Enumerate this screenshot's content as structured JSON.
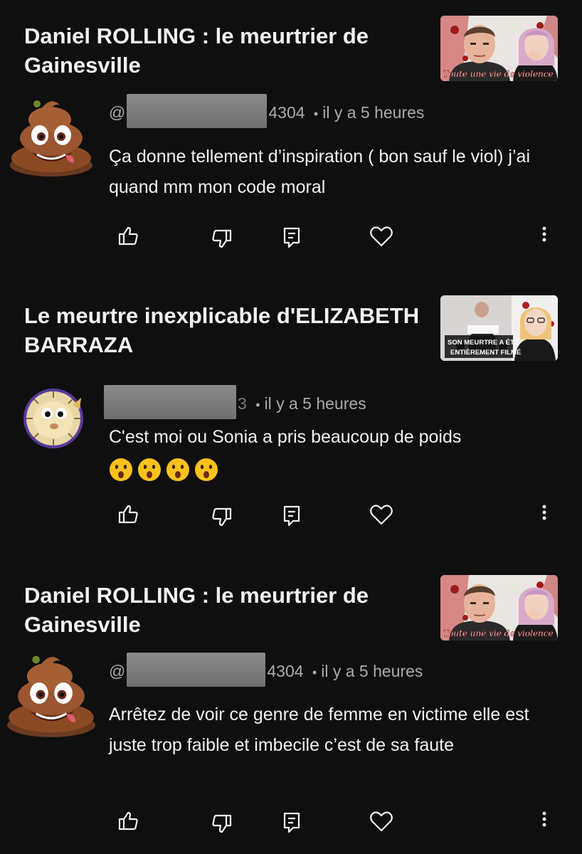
{
  "colors": {
    "background": "#0f0f0f",
    "primary_text": "#f1f1f1",
    "secondary_text": "#aaaaaa",
    "redaction": "#7a7a7a"
  },
  "items": [
    {
      "video_title": "Daniel ROLLING : le meurtrier de Gainesville",
      "thumbnail_caption": "Toute une vie de violence",
      "avatar_icon": "poop-emoji-icon",
      "handle_prefix": "@",
      "handle_suffix": "4304",
      "separator": "•",
      "timestamp": "il y a 5 heures",
      "comment": "Ça donne tellement d’inspiration ( bon sauf le viol) j’ai quand mm mon code moral",
      "emoji": []
    },
    {
      "video_title": "Le meurtre inexplicable d'ELIZABETH BARRAZA",
      "thumbnail_caption_lines": [
        "SON MEURTRE A ÉTÉ",
        "ENTIÈREMENT FILMÉ"
      ],
      "avatar_icon": "pufferfish-icon",
      "handle_prefix": "",
      "handle_suffix": "3",
      "separator": "•",
      "timestamp": "il y a 5 heures",
      "comment": "C'est moi ou Sonia a pris beaucoup de poids",
      "emoji": [
        "hushed-face-emoji",
        "hushed-face-emoji",
        "hushed-face-emoji",
        "hushed-face-emoji"
      ]
    },
    {
      "video_title": "Daniel ROLLING : le meurtrier de Gainesville",
      "thumbnail_caption": "Toute une vie de violence",
      "avatar_icon": "poop-emoji-icon",
      "handle_prefix": "@",
      "handle_suffix": "4304",
      "separator": "•",
      "timestamp": "il y a 5 heures",
      "comment": "Arrêtez de voir ce genre de femme en victime elle est juste trop faible et imbecile c’est de sa faute",
      "emoji": []
    }
  ],
  "actions": [
    "like-icon",
    "dislike-icon",
    "reply-icon",
    "heart-icon",
    "more-options-icon"
  ]
}
